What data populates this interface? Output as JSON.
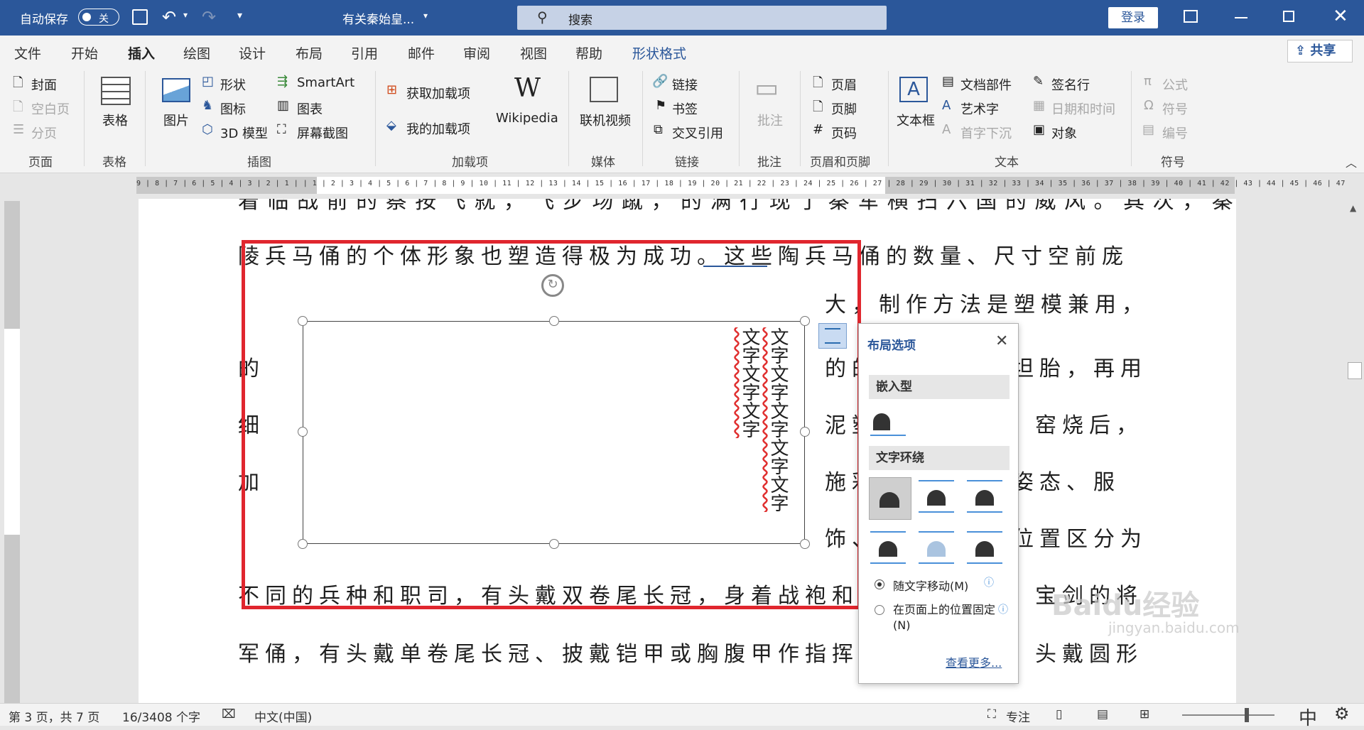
{
  "titlebar": {
    "autosave_label": "自动保存",
    "autosave_state": "关",
    "doc_title": "有关秦始皇...",
    "search_placeholder": "搜索",
    "login_label": "登录"
  },
  "tabs": [
    "文件",
    "开始",
    "插入",
    "绘图",
    "设计",
    "布局",
    "引用",
    "邮件",
    "审阅",
    "视图",
    "帮助",
    "形状格式"
  ],
  "active_tab": "插入",
  "share_label": "共享",
  "ribbon": {
    "page_group": {
      "items": [
        "封面",
        "空白页",
        "分页"
      ],
      "label": "页面"
    },
    "table_group": {
      "item": "表格",
      "label": "表格"
    },
    "illus_group": {
      "picture": "图片",
      "items": [
        "形状",
        "图标",
        "3D 模型",
        "SmartArt",
        "图表",
        "屏幕截图"
      ],
      "label": "插图"
    },
    "addins_group": {
      "items": [
        "获取加载项",
        "我的加载项"
      ],
      "wiki": "Wikipedia",
      "label": "加载项"
    },
    "media_group": {
      "item": "联机视频",
      "label": "媒体"
    },
    "links_group": {
      "items": [
        "链接",
        "书签",
        "交叉引用"
      ],
      "label": "链接"
    },
    "comment_group": {
      "item": "批注",
      "label": "批注"
    },
    "hf_group": {
      "items": [
        "页眉",
        "页脚",
        "页码"
      ],
      "label": "页眉和页脚"
    },
    "text_group": {
      "textbox": "文本框",
      "items": [
        "文档部件",
        "艺术字",
        "首字下沉",
        "签名行",
        "日期和时间",
        "对象"
      ],
      "label": "文本"
    },
    "symbol_group": {
      "items": [
        "公式",
        "符号",
        "编号"
      ],
      "label": "符号"
    }
  },
  "ruler_numbers": "9 | 8 | 7 | 6 | 5 | 4 | 3 | 2 | 1 |   | 1 | 2 | 3 | 4 | 5 | 6 | 7 | 8 | 9 | 10 | 11 | 12 | 13 | 14 | 15 | 16 | 17 | 18 | 19 | 20 | 21 | 22 | 23 | 24 | 25 | 26 | 27 | 28 | 29 | 30 | 31 | 32 | 33 | 34 | 35 | 36 | 37 | 38 | 39 | 40 | 41 | 42 | 43 | 44 | 45 | 46 | 47",
  "document": {
    "line0": "着 临 战 前 的 察 按 飞 就 ， 飞 步 场 蹴 ， 的 满 行 现 了 秦 军 横 扫 六 国 的 威 风 。 其 次 ， 秦",
    "line1": "陵兵马俑的个体形象也塑造得极为成功。这些陶兵马俑的数量、尺寸空前庞",
    "line2": "大，制作方法是塑模兼用，",
    "line3a": "的",
    "line3b": "的的",
    "line3c": "坦胎，再用",
    "line4a": "细",
    "line4b": "泥塑",
    "line4c": "窑烧后，",
    "line5a": "加",
    "line5b": "施彩",
    "line5c": "姿态、服",
    "line6a": "饰、",
    "line6b": "位置区分为",
    "line7a": "不同的兵种和职司，有头戴双卷尾长冠，身着战袍和鱼",
    "line7b": "宝剑的将",
    "line8a": "军俑，有头戴单卷尾长冠、披戴铠甲或胸腹甲作指挥状",
    "line8b": "头戴圆形"
  },
  "shape_text": {
    "col1": "文字文字文字",
    "col2": "文字文字文字文字文字"
  },
  "layout_panel": {
    "title": "布局选项",
    "inline_label": "嵌入型",
    "wrap_label": "文字环绕",
    "move_with_text": "随文字移动(M)",
    "fix_position": "在页面上的位置固定(N)",
    "see_more": "查看更多..."
  },
  "status": {
    "page": "第 3 页，共 7 页",
    "words": "16/3408 个字",
    "language": "中文(中国)",
    "focus": "专注",
    "ime": "中"
  },
  "watermark": "Baidu经验 jingyan.baidu.com"
}
